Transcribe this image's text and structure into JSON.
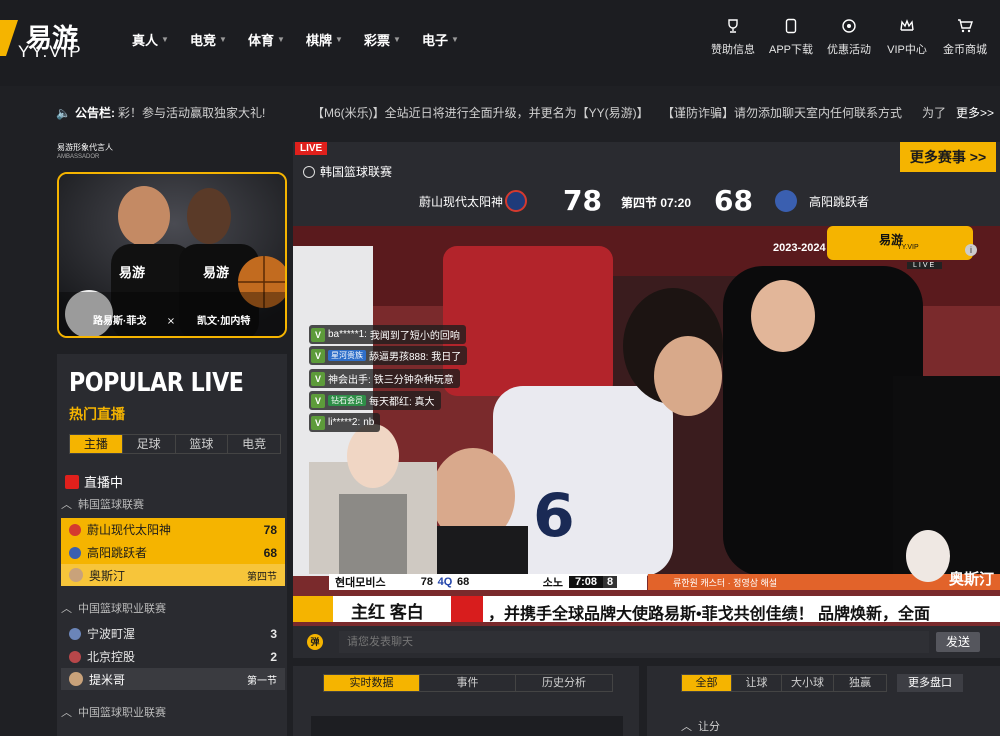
{
  "brand": {
    "cn": "易游",
    "en": "YY.VIP"
  },
  "nav": [
    {
      "label": "真人"
    },
    {
      "label": "电竞"
    },
    {
      "label": "体育"
    },
    {
      "label": "棋牌"
    },
    {
      "label": "彩票"
    },
    {
      "label": "电子"
    }
  ],
  "top_links": [
    {
      "label": "赞助信息",
      "icon": "trophy-icon"
    },
    {
      "label": "APP下载",
      "icon": "phone-icon"
    },
    {
      "label": "优惠活动",
      "icon": "gift-icon"
    },
    {
      "label": "VIP中心",
      "icon": "crown-icon"
    },
    {
      "label": "金币商城",
      "icon": "cart-icon"
    }
  ],
  "notice": {
    "label": "公告栏:",
    "items": [
      "彩！参与活动赢取独家大礼!",
      "【M6(米乐)】全站近日将进行全面升级，并更名为【YY(易游)】",
      "【谨防诈骗】请勿添加聊天室内任何联系方式",
      "为了"
    ],
    "more": "更多>>"
  },
  "ambassador": {
    "title": "易游形象代言人",
    "subtitle": "AMBASSADOR",
    "left_name": "路易斯·菲戈",
    "right_name": "凯文·加内特",
    "logo_text": "易游"
  },
  "popular": {
    "en": "POPULAR LIVE",
    "cn": "热门直播",
    "tabs": [
      "主播",
      "足球",
      "篮球",
      "电竞"
    ],
    "live_label": "直播中",
    "groups": [
      {
        "league": "韩国篮球联赛",
        "home": "蔚山现代太阳神",
        "home_score": "78",
        "away": "高阳跳跃者",
        "away_score": "68",
        "anchor": "奥斯汀",
        "period": "第四节"
      },
      {
        "league": "中国篮球职业联赛",
        "home": "宁波町渥",
        "home_score": "3",
        "away": "北京控股",
        "away_score": "2",
        "anchor": "提米哥",
        "period": "第一节"
      },
      {
        "league": "中国篮球职业联赛"
      }
    ]
  },
  "player": {
    "live_tag": "LIVE",
    "league": "韩国篮球联赛",
    "more_events": "更多赛事 >>",
    "home": "蔚山现代太阳神",
    "home_score": "78",
    "period_time": "第四节 07:20",
    "away_score": "68",
    "away": "高阳跳跃者"
  },
  "video": {
    "season": "2023-2024",
    "brand_cn": "易游",
    "brand_en": "YY.VIP",
    "brand_live": "LIVE",
    "chat": [
      {
        "user": "ba*****1:",
        "msg": "我闻到了短小的回响",
        "tag": ""
      },
      {
        "user": "",
        "msg": "舔逼男孩888: 我日了",
        "tag": "星河贵族"
      },
      {
        "user": "神会出手:",
        "msg": "铁三分钟杂种玩意",
        "tag": ""
      },
      {
        "user": "",
        "msg": "每天都红: 真大",
        "tag": "钻石会员"
      },
      {
        "user": "li*****2:",
        "msg": "nb",
        "tag": ""
      }
    ],
    "overlay_home": "현대모비스",
    "overlay_home_score": "78",
    "overlay_q": "4Q",
    "overlay_away_score": "68",
    "overlay_away": "소노",
    "overlay_clock": "7:08",
    "overlay_shot": "8",
    "overlay_credit": "류한원 캐스터 · 정영삼 해설",
    "streamer": "奥斯汀",
    "ticker_left": "主红 客白",
    "ticker_right": "，并携手全球品牌大使路易斯•菲戈共创佳绩！ 品牌焕新，全面"
  },
  "chat_input": {
    "placeholder": "请您发表聊天",
    "send": "发送",
    "icon_text": "弹"
  },
  "stats_panel": {
    "tabs": [
      "实时数据",
      "事件",
      "历史分析"
    ]
  },
  "odds_panel": {
    "tabs": [
      "全部",
      "让球",
      "大小球",
      "独赢"
    ],
    "more": "更多盘口",
    "first_row": "让分"
  },
  "colors": {
    "accent": "#f5b400",
    "bg": "#1f2024",
    "live": "#e0201c"
  }
}
